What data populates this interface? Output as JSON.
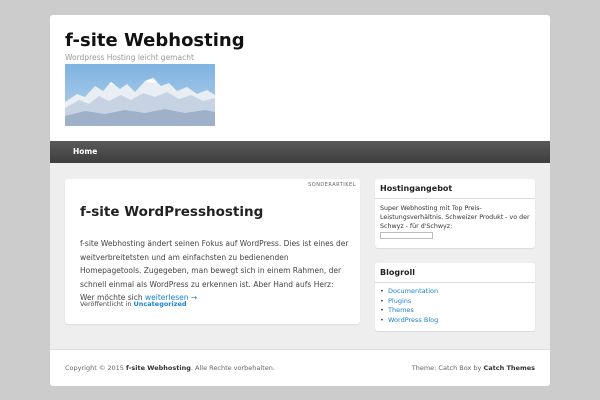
{
  "header": {
    "site_title": "f-site Webhosting",
    "site_description": "Wordpress Hosting leicht gemacht",
    "header_image": "snowy-mountain-range-photo"
  },
  "nav": {
    "items": [
      {
        "label": "Home"
      }
    ]
  },
  "article": {
    "featured_label": "SONDERARTIKEL",
    "title": "f-site WordPresshosting",
    "excerpt": "f-site Webhosting ändert seinen Fokus auf WordPress. Dies ist eines der weitverbreitetsten und am einfachsten zu bedienenden Homepagetools. Zugegeben, man bewegt sich in einem Rahmen, der schnell einmal als WordPress zu erkennen ist. Aber Hand aufs Herz: Wer möchte sich",
    "read_more": "weiterlesen →",
    "meta_prefix": "Veröffentlicht in",
    "category": "Uncategorized"
  },
  "sidebar": {
    "hosting": {
      "title": "Hostingangebot",
      "text": "Super Webhosting mit Top Preis-Leistungsverhältnis. Schweizer Produkt - vo der Schwyz - für d'Schwyz:"
    },
    "blogroll": {
      "title": "Blogroll",
      "links": [
        "Documentation",
        "Plugins",
        "Themes",
        "WordPress Blog"
      ]
    }
  },
  "footer": {
    "copyright_prefix": "Copyright © 2015",
    "copyright_site": "f-site Webhosting",
    "copyright_suffix": ". Alle Rechte vorbehalten.",
    "theme_prefix": "Theme: Catch Box by",
    "theme_author": "Catch Themes"
  }
}
